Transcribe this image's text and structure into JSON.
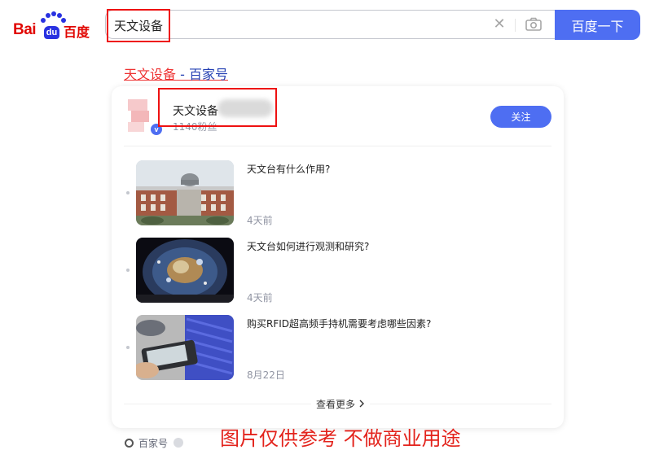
{
  "logo": {
    "latin": "Bai",
    "du": "du",
    "chinese": "百度"
  },
  "search": {
    "value": "天文设备",
    "button_label": "百度一下"
  },
  "result": {
    "title_main": "天文设备",
    "title_sep": " - ",
    "title_source": "百家号"
  },
  "author": {
    "name": "天文设备",
    "fans": "1140粉丝",
    "follow_label": "关注",
    "verified_mark": "v"
  },
  "articles": [
    {
      "title": "天文台有什么作用?",
      "time": "4天前"
    },
    {
      "title": "天文台如何进行观测和研究?",
      "time": "4天前"
    },
    {
      "title": "购买RFID超高频手持机需要考虑哪些因素?",
      "time": "8月22日"
    }
  ],
  "more_label": "查看更多",
  "footer": {
    "source_name": "百家号"
  },
  "watermark": "图片仅供参考 不做商业用途",
  "colors": {
    "accent": "#4e6ef2",
    "brand_red": "#e10601",
    "highlight": "#e11111"
  }
}
